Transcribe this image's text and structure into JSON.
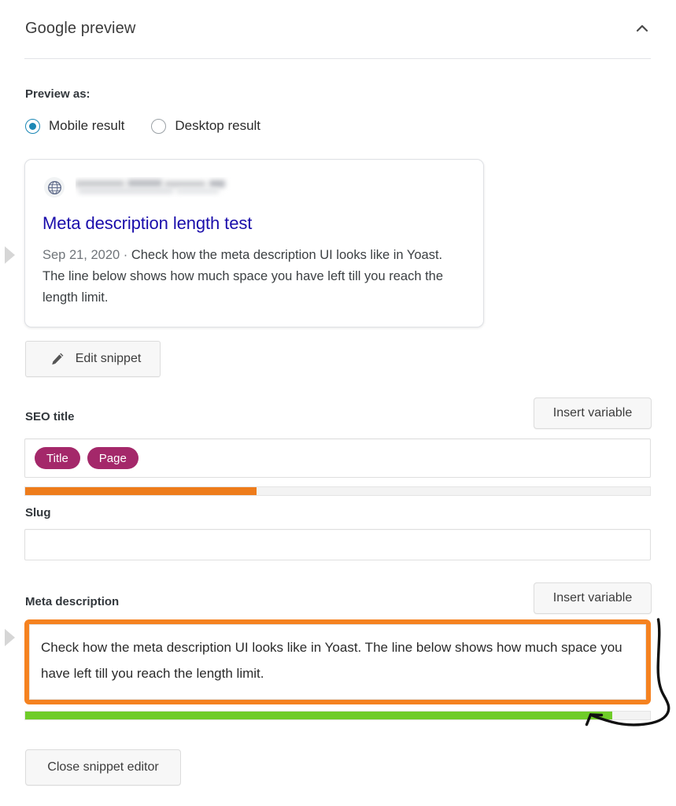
{
  "panel": {
    "title": "Google preview",
    "collapse_icon": "chevron-up-icon"
  },
  "preview_as": {
    "label": "Preview as:",
    "options": [
      {
        "label": "Mobile result",
        "selected": true
      },
      {
        "label": "Desktop result",
        "selected": false
      }
    ]
  },
  "snippet_preview": {
    "favicon_icon": "globe-icon",
    "url": "",
    "url_redacted": true,
    "title": "Meta description length test",
    "date": "Sep 21, 2020",
    "separator": "·",
    "description": "Check how the meta description UI looks like in Yoast. The line below shows how much space you have left till you reach the length limit."
  },
  "edit_snippet_button": {
    "label": "Edit snippet",
    "icon": "pencil-icon"
  },
  "seo_title": {
    "label": "SEO title",
    "insert_variable_label": "Insert variable",
    "tags": [
      "Title",
      "Page"
    ],
    "progress_percent": 37,
    "progress_color": "#ee7c1b"
  },
  "slug": {
    "label": "Slug",
    "value": "",
    "placeholder": ""
  },
  "meta_description": {
    "label": "Meta description",
    "insert_variable_label": "Insert variable",
    "value": "Check how the meta description UI looks like in Yoast. The line below shows how much space you have left till you reach the length limit.",
    "progress_percent": 94,
    "progress_color": "#6fcc28",
    "highlight_color": "#f58220"
  },
  "close_button": {
    "label": "Close snippet editor"
  },
  "annotations": {
    "arrow": "hand-drawn-arrow-pointing-to-meta-description-progress-bar"
  },
  "colors": {
    "link_blue": "#1a0dab",
    "radio_blue": "#1b87b5",
    "tag_magenta": "#a4286a",
    "orange": "#ee7c1b",
    "green": "#6fcc28",
    "highlight_orange": "#f58220"
  }
}
